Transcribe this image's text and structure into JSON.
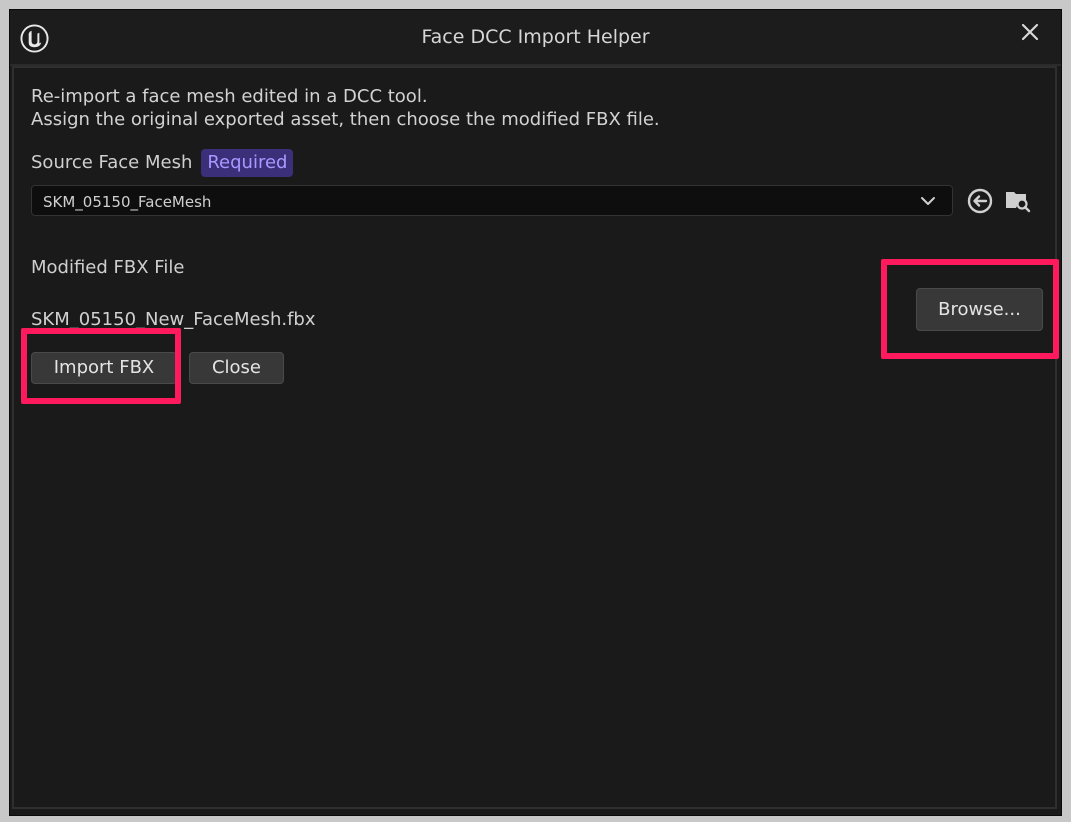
{
  "window": {
    "title": "Face DCC Import Helper"
  },
  "description": {
    "line1": "Re-import a face mesh edited in a DCC tool.",
    "line2": "Assign the original exported asset, then choose the modified FBX file."
  },
  "source_mesh": {
    "label": "Source Face Mesh",
    "badge": "Required",
    "selected_value": "SKM_05150_FaceMesh"
  },
  "fbx": {
    "label": "Modified FBX File",
    "file_name": "SKM_05150_New_FaceMesh.fbx",
    "browse_label": "Browse..."
  },
  "actions": {
    "import_label": "Import FBX",
    "close_label": "Close"
  },
  "colors": {
    "highlight": "#ff1a5e",
    "badge_bg": "#3a2f78",
    "badge_text": "#a998ff",
    "panel_bg": "#1a1a1a"
  },
  "icons": {
    "app": "unreal-logo-icon",
    "close": "close-icon",
    "dropdown": "chevron-down-icon",
    "use_selected": "use-selected-asset-icon",
    "browse_asset": "browse-to-asset-icon"
  }
}
